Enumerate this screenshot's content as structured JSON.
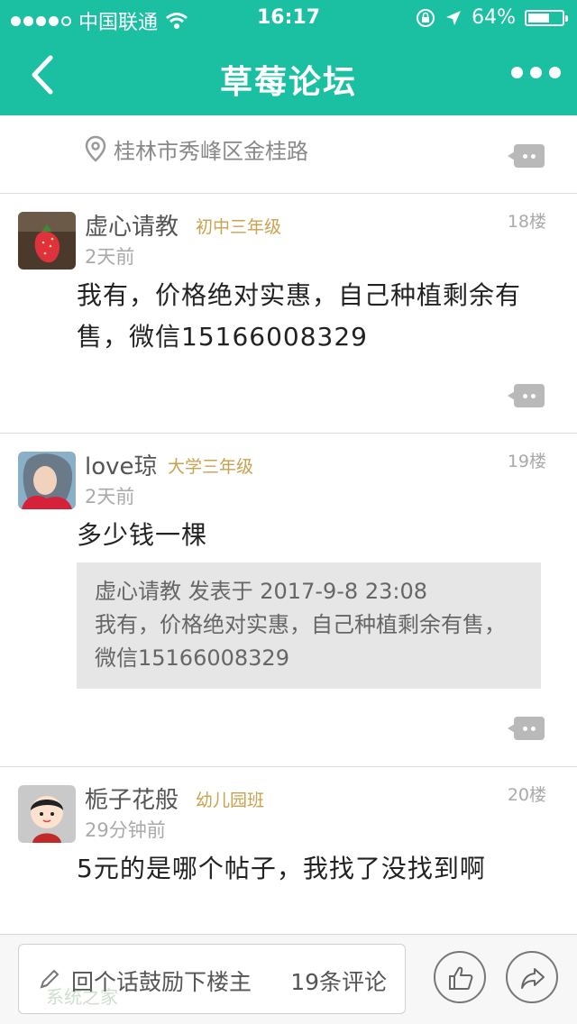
{
  "status_bar": {
    "carrier": "中国联通",
    "time": "16:17",
    "battery_percent": "64%",
    "battery_level": 0.64
  },
  "nav": {
    "title": "草莓论坛"
  },
  "location": {
    "text": "桂林市秀峰区金桂路"
  },
  "posts": [
    {
      "username": "虚心请教",
      "level": "初中三年级",
      "floor": "18楼",
      "time": "2天前",
      "content": "我有，价格绝对实惠，自己种植剩余有售，微信15166008329"
    },
    {
      "username": "love琼",
      "level": "大学三年级",
      "floor": "19楼",
      "time": "2天前",
      "content": "多少钱一棵",
      "quote": {
        "header": "虚心请教 发表于 2017-9-8 23:08",
        "body": "我有，价格绝对实惠，自己种植剩余有售，微信15166008329"
      }
    },
    {
      "username": "栀子花般",
      "level": "幼儿园班",
      "floor": "20楼",
      "time": "29分钟前",
      "content": "5元的是哪个帖子，我找了没找到啊"
    }
  ],
  "bottom_bar": {
    "reply_placeholder": "回个话鼓励下楼主",
    "comment_count": "19条评论",
    "watermark": "系统之家"
  },
  "colors": {
    "brand": "#1bbfa2",
    "level": "#caa24f"
  }
}
